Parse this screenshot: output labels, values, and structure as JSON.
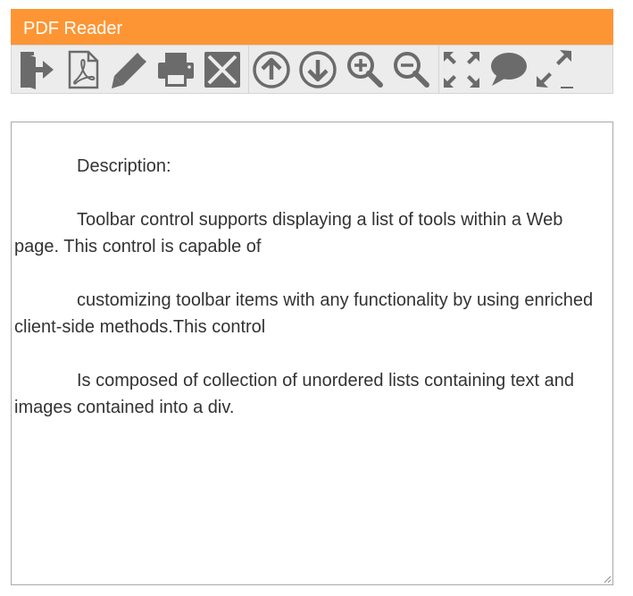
{
  "window": {
    "title": "PDF Reader"
  },
  "toolbar": {
    "tools": [
      {
        "name": "exit-icon",
        "label": "Exit"
      },
      {
        "name": "pdf-icon",
        "label": "PDF"
      },
      {
        "name": "pencil-icon",
        "label": "Edit"
      },
      {
        "name": "print-icon",
        "label": "Print"
      },
      {
        "name": "close-icon",
        "label": "Close"
      },
      {
        "name": "arrow-up-circle-icon",
        "label": "Previous page"
      },
      {
        "name": "arrow-down-circle-icon",
        "label": "Next page"
      },
      {
        "name": "zoom-in-icon",
        "label": "Zoom in"
      },
      {
        "name": "zoom-out-icon",
        "label": "Zoom out"
      },
      {
        "name": "fit-screen-icon",
        "label": "Fit to page"
      },
      {
        "name": "comment-icon",
        "label": "Comment"
      },
      {
        "name": "expand-icon",
        "label": "Fullscreen"
      }
    ]
  },
  "editor": {
    "paragraphs": [
      "Description:",
      "Toolbar control supports displaying a list of tools within a Web page. This control is capable of",
      "customizing toolbar items with any functionality by using enriched client-side methods.This control",
      "Is composed of collection of unordered lists containing text and images contained into a div."
    ]
  },
  "colors": {
    "title_bar": "#fe9534",
    "toolbar_bg": "#ececec",
    "icon": "#6b6b6b",
    "text": "#333333"
  }
}
